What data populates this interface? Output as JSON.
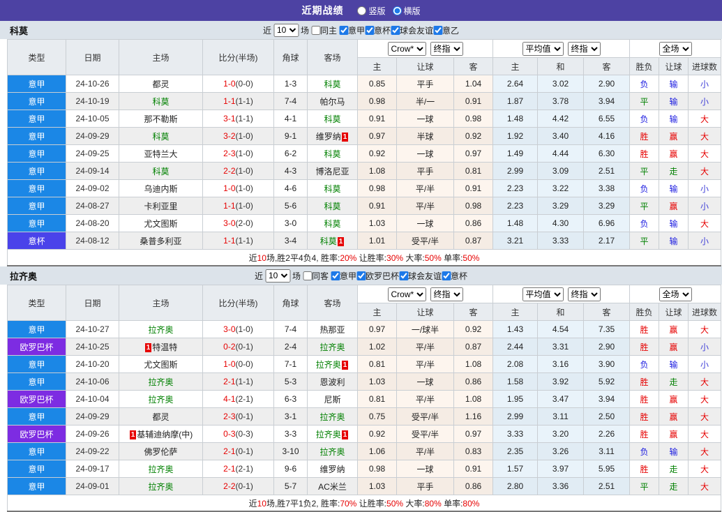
{
  "title_bar": {
    "title": "近期战绩",
    "radio_vertical": "竖版",
    "radio_horizontal": "横版"
  },
  "card_badge": "1",
  "table_header": {
    "type": "类型",
    "date": "日期",
    "home": "主场",
    "score": "比分(半场)",
    "corner": "角球",
    "away": "客场",
    "odds_selects": [
      "Crow*",
      "终指"
    ],
    "odds_cols": [
      "主",
      "让球",
      "客"
    ],
    "avg_selects": [
      "平均值",
      "终指"
    ],
    "avg_cols": [
      "主",
      "和",
      "客"
    ],
    "full_select": "全场",
    "result_cols": [
      "胜负",
      "让球",
      "进球数"
    ]
  },
  "colors": {
    "header_bar": "#4d42a3",
    "section_bar": "#dce3ea",
    "score_red": "#e60000",
    "focus_team_green": "#008000",
    "league": {
      "意甲": "#1b87e6",
      "意杯": "#4a43ea",
      "欧罗巴杯": "#7d2ce2"
    },
    "result": {
      "胜": "#e60000",
      "平": "#008000",
      "负": "#1a1ae0",
      "赢": "#e60000",
      "输": "#1a1ae0",
      "走": "#008000",
      "大": "#e60000",
      "小": "#4040d8"
    }
  },
  "sections": [
    {
      "team": "科莫",
      "filter": {
        "near_label": "近",
        "count": "10",
        "games_label": "场",
        "same_label": "同主",
        "leagues": [
          "意甲",
          "意杯",
          "球会友谊",
          "意乙"
        ]
      },
      "rows": [
        {
          "league": "意甲",
          "date": "24-10-26",
          "home": "都灵",
          "score_ft": "1-0",
          "score_ht": "(0-0)",
          "corner": "1-3",
          "away": "科莫",
          "odds": [
            "0.85",
            "平手",
            "1.04"
          ],
          "avg": [
            "2.64",
            "3.02",
            "2.90"
          ],
          "result": [
            "负",
            "输",
            "小"
          ]
        },
        {
          "league": "意甲",
          "date": "24-10-19",
          "home": "科莫",
          "score_ft": "1-1",
          "score_ht": "(1-1)",
          "corner": "7-4",
          "away": "帕尔马",
          "odds": [
            "0.98",
            "半/一",
            "0.91"
          ],
          "avg": [
            "1.87",
            "3.78",
            "3.94"
          ],
          "result": [
            "平",
            "输",
            "小"
          ]
        },
        {
          "league": "意甲",
          "date": "24-10-05",
          "home": "那不勒斯",
          "score_ft": "3-1",
          "score_ht": "(1-1)",
          "corner": "4-1",
          "away": "科莫",
          "odds": [
            "0.91",
            "一球",
            "0.98"
          ],
          "avg": [
            "1.48",
            "4.42",
            "6.55"
          ],
          "result": [
            "负",
            "输",
            "大"
          ]
        },
        {
          "league": "意甲",
          "date": "24-09-29",
          "home": "科莫",
          "score_ft": "3-2",
          "score_ht": "(1-0)",
          "corner": "9-1",
          "away": "维罗纳",
          "away_card": true,
          "odds": [
            "0.97",
            "半球",
            "0.92"
          ],
          "avg": [
            "1.92",
            "3.40",
            "4.16"
          ],
          "result": [
            "胜",
            "赢",
            "大"
          ]
        },
        {
          "league": "意甲",
          "date": "24-09-25",
          "home": "亚特兰大",
          "score_ft": "2-3",
          "score_ht": "(1-0)",
          "corner": "6-2",
          "away": "科莫",
          "odds": [
            "0.92",
            "一球",
            "0.97"
          ],
          "avg": [
            "1.49",
            "4.44",
            "6.30"
          ],
          "result": [
            "胜",
            "赢",
            "大"
          ]
        },
        {
          "league": "意甲",
          "date": "24-09-14",
          "home": "科莫",
          "score_ft": "2-2",
          "score_ht": "(1-0)",
          "corner": "4-3",
          "away": "博洛尼亚",
          "odds": [
            "1.08",
            "平手",
            "0.81"
          ],
          "avg": [
            "2.99",
            "3.09",
            "2.51"
          ],
          "result": [
            "平",
            "走",
            "大"
          ]
        },
        {
          "league": "意甲",
          "date": "24-09-02",
          "home": "乌迪内斯",
          "score_ft": "1-0",
          "score_ht": "(1-0)",
          "corner": "4-6",
          "away": "科莫",
          "odds": [
            "0.98",
            "平/半",
            "0.91"
          ],
          "avg": [
            "2.23",
            "3.22",
            "3.38"
          ],
          "result": [
            "负",
            "输",
            "小"
          ]
        },
        {
          "league": "意甲",
          "date": "24-08-27",
          "home": "卡利亚里",
          "score_ft": "1-1",
          "score_ht": "(1-0)",
          "corner": "5-6",
          "away": "科莫",
          "odds": [
            "0.91",
            "平/半",
            "0.98"
          ],
          "avg": [
            "2.23",
            "3.29",
            "3.29"
          ],
          "result": [
            "平",
            "赢",
            "小"
          ]
        },
        {
          "league": "意甲",
          "date": "24-08-20",
          "home": "尤文图斯",
          "score_ft": "3-0",
          "score_ht": "(2-0)",
          "corner": "3-0",
          "away": "科莫",
          "odds": [
            "1.03",
            "一球",
            "0.86"
          ],
          "avg": [
            "1.48",
            "4.30",
            "6.96"
          ],
          "result": [
            "负",
            "输",
            "大"
          ]
        },
        {
          "league": "意杯",
          "date": "24-08-12",
          "home": "桑普多利亚",
          "score_ft": "1-1",
          "score_ht": "(1-1)",
          "corner": "3-4",
          "away": "科莫",
          "away_card": true,
          "odds": [
            "1.01",
            "受平/半",
            "0.87"
          ],
          "avg": [
            "3.21",
            "3.33",
            "2.17"
          ],
          "result": [
            "平",
            "输",
            "小"
          ]
        }
      ],
      "summary": [
        {
          "t": "近",
          "c": "k"
        },
        {
          "t": "10",
          "c": "r"
        },
        {
          "t": "场,胜2平4负4, 胜率:",
          "c": "k"
        },
        {
          "t": "20%",
          "c": "r"
        },
        {
          "t": " 让胜率:",
          "c": "k"
        },
        {
          "t": "30%",
          "c": "r"
        },
        {
          "t": " 大率:",
          "c": "k"
        },
        {
          "t": "50%",
          "c": "r"
        },
        {
          "t": " 单率:",
          "c": "k"
        },
        {
          "t": "50%",
          "c": "r"
        }
      ]
    },
    {
      "team": "拉齐奥",
      "filter": {
        "near_label": "近",
        "count": "10",
        "games_label": "场",
        "same_label": "同客",
        "leagues": [
          "意甲",
          "欧罗巴杯",
          "球会友谊",
          "意杯"
        ]
      },
      "rows": [
        {
          "league": "意甲",
          "date": "24-10-27",
          "home": "拉齐奥",
          "score_ft": "3-0",
          "score_ht": "(1-0)",
          "corner": "7-4",
          "away": "热那亚",
          "odds": [
            "0.97",
            "一/球半",
            "0.92"
          ],
          "avg": [
            "1.43",
            "4.54",
            "7.35"
          ],
          "result": [
            "胜",
            "赢",
            "大"
          ]
        },
        {
          "league": "欧罗巴杯",
          "date": "24-10-25",
          "home": "特温特",
          "home_card": true,
          "score_ft": "0-2",
          "score_ht": "(0-1)",
          "corner": "2-4",
          "away": "拉齐奥",
          "odds": [
            "1.02",
            "平/半",
            "0.87"
          ],
          "avg": [
            "2.44",
            "3.31",
            "2.90"
          ],
          "result": [
            "胜",
            "赢",
            "小"
          ]
        },
        {
          "league": "意甲",
          "date": "24-10-20",
          "home": "尤文图斯",
          "score_ft": "1-0",
          "score_ht": "(0-0)",
          "corner": "7-1",
          "away": "拉齐奥",
          "away_card": true,
          "odds": [
            "0.81",
            "平/半",
            "1.08"
          ],
          "avg": [
            "2.08",
            "3.16",
            "3.90"
          ],
          "result": [
            "负",
            "输",
            "小"
          ]
        },
        {
          "league": "意甲",
          "date": "24-10-06",
          "home": "拉齐奥",
          "score_ft": "2-1",
          "score_ht": "(1-1)",
          "corner": "5-3",
          "away": "恩波利",
          "odds": [
            "1.03",
            "一球",
            "0.86"
          ],
          "avg": [
            "1.58",
            "3.92",
            "5.92"
          ],
          "result": [
            "胜",
            "走",
            "大"
          ]
        },
        {
          "league": "欧罗巴杯",
          "date": "24-10-04",
          "home": "拉齐奥",
          "score_ft": "4-1",
          "score_ht": "(2-1)",
          "corner": "6-3",
          "away": "尼斯",
          "odds": [
            "0.81",
            "平/半",
            "1.08"
          ],
          "avg": [
            "1.95",
            "3.47",
            "3.94"
          ],
          "result": [
            "胜",
            "赢",
            "大"
          ]
        },
        {
          "league": "意甲",
          "date": "24-09-29",
          "home": "都灵",
          "score_ft": "2-3",
          "score_ht": "(0-1)",
          "corner": "3-1",
          "away": "拉齐奥",
          "odds": [
            "0.75",
            "受平/半",
            "1.16"
          ],
          "avg": [
            "2.99",
            "3.11",
            "2.50"
          ],
          "result": [
            "胜",
            "赢",
            "大"
          ]
        },
        {
          "league": "欧罗巴杯",
          "date": "24-09-26",
          "home": "基辅迪纳摩(中)",
          "home_card": true,
          "score_ft": "0-3",
          "score_ht": "(0-3)",
          "corner": "3-3",
          "away": "拉齐奥",
          "away_card": true,
          "odds": [
            "0.92",
            "受平/半",
            "0.97"
          ],
          "avg": [
            "3.33",
            "3.20",
            "2.26"
          ],
          "result": [
            "胜",
            "赢",
            "大"
          ]
        },
        {
          "league": "意甲",
          "date": "24-09-22",
          "home": "佛罗伦萨",
          "score_ft": "2-1",
          "score_ht": "(0-1)",
          "corner": "3-10",
          "away": "拉齐奥",
          "odds": [
            "1.06",
            "平/半",
            "0.83"
          ],
          "avg": [
            "2.35",
            "3.26",
            "3.11"
          ],
          "result": [
            "负",
            "输",
            "大"
          ]
        },
        {
          "league": "意甲",
          "date": "24-09-17",
          "home": "拉齐奥",
          "score_ft": "2-1",
          "score_ht": "(2-1)",
          "corner": "9-6",
          "away": "维罗纳",
          "odds": [
            "0.98",
            "一球",
            "0.91"
          ],
          "avg": [
            "1.57",
            "3.97",
            "5.95"
          ],
          "result": [
            "胜",
            "走",
            "大"
          ]
        },
        {
          "league": "意甲",
          "date": "24-09-01",
          "home": "拉齐奥",
          "score_ft": "2-2",
          "score_ht": "(0-1)",
          "corner": "5-7",
          "away": "AC米兰",
          "odds": [
            "1.03",
            "平手",
            "0.86"
          ],
          "avg": [
            "2.80",
            "3.36",
            "2.51"
          ],
          "result": [
            "平",
            "走",
            "大"
          ]
        }
      ],
      "summary": [
        {
          "t": "近",
          "c": "k"
        },
        {
          "t": "10",
          "c": "r"
        },
        {
          "t": "场,胜7平1负2, 胜率:",
          "c": "k"
        },
        {
          "t": "70%",
          "c": "r"
        },
        {
          "t": " 让胜率:",
          "c": "k"
        },
        {
          "t": "50%",
          "c": "r"
        },
        {
          "t": " 大率:",
          "c": "k"
        },
        {
          "t": "80%",
          "c": "r"
        },
        {
          "t": " 单率:",
          "c": "k"
        },
        {
          "t": "80%",
          "c": "r"
        }
      ]
    }
  ]
}
